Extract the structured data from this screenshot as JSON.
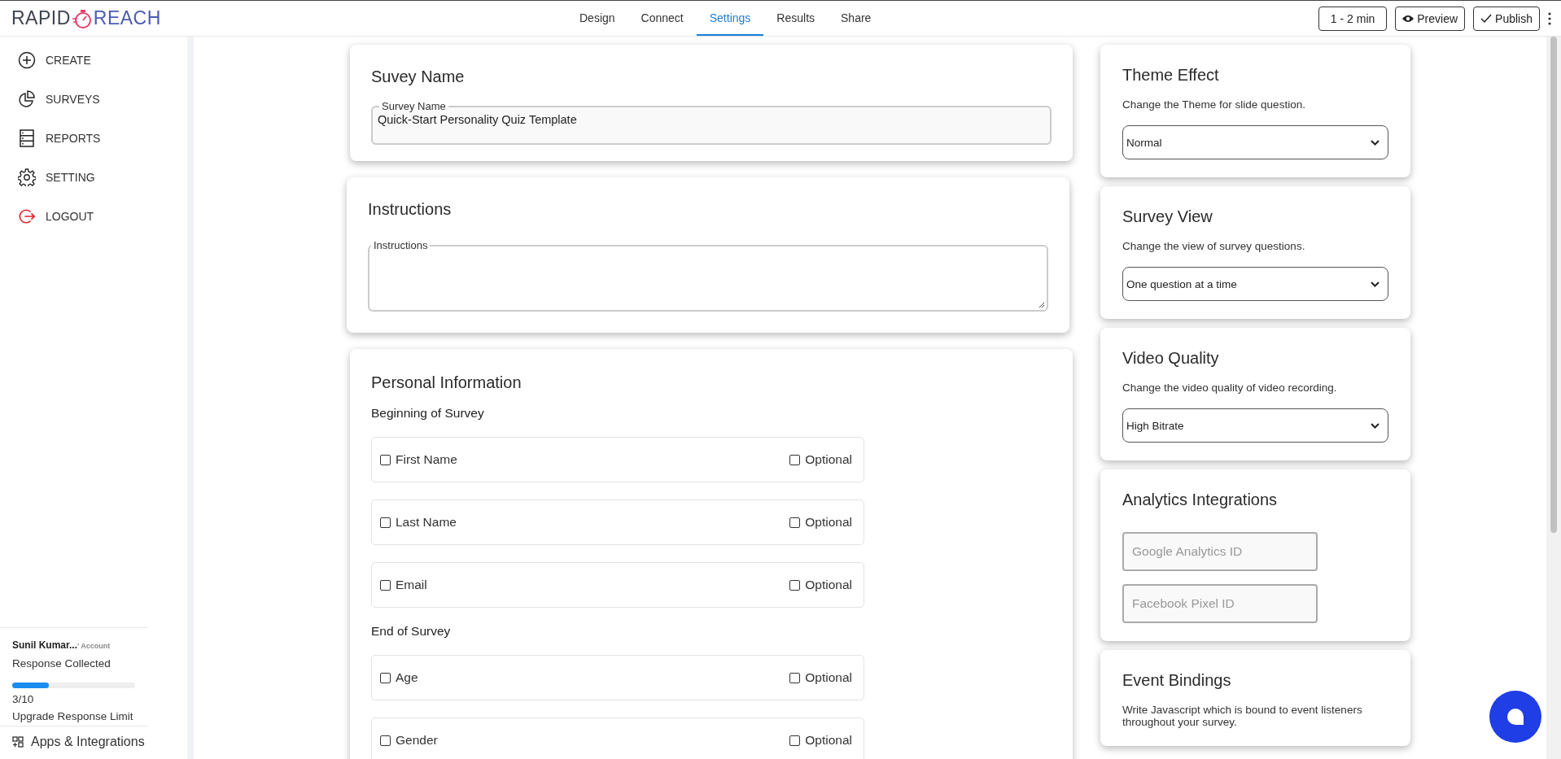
{
  "header": {
    "logo_left": "RAPID",
    "logo_right": "REACH",
    "tabs": [
      {
        "label": "Design",
        "selected": false
      },
      {
        "label": "Connect",
        "selected": false
      },
      {
        "label": "Settings",
        "selected": true
      },
      {
        "label": "Results",
        "selected": false
      },
      {
        "label": "Share",
        "selected": false
      }
    ],
    "duration": "1 - 2 min",
    "preview": "Preview",
    "publish": "Publish"
  },
  "sidebar": {
    "items": [
      {
        "label": "CREATE"
      },
      {
        "label": "SURVEYS"
      },
      {
        "label": "REPORTS"
      },
      {
        "label": "SETTING"
      },
      {
        "label": "LOGOUT"
      }
    ],
    "account": {
      "name": "Sunil Kumar...",
      "suffix": "' Account"
    },
    "usage": {
      "label": "Response Collected",
      "level": 0.3,
      "count": "3/10",
      "upgrade": "Upgrade Response Limit"
    },
    "apps": "Apps & Integrations"
  },
  "survey_name": {
    "title": "Suvey Name",
    "field_label": "Survey Name",
    "value": "Quick-Start Personality Quiz Template"
  },
  "instructions": {
    "title": "Instructions",
    "field_label": "Instructions"
  },
  "personal_information": {
    "title": "Personal Information",
    "groups": [
      {
        "heading": "Beginning of Survey",
        "fields": [
          {
            "label": "First Name",
            "checked": false,
            "optional_label": "Optional",
            "optional_checked": false
          },
          {
            "label": "Last Name",
            "checked": false,
            "optional_label": "Optional",
            "optional_checked": false
          },
          {
            "label": "Email",
            "checked": false,
            "optional_label": "Optional",
            "optional_checked": false
          }
        ]
      },
      {
        "heading": "End of Survey",
        "fields": [
          {
            "label": "Age",
            "checked": false,
            "optional_label": "Optional",
            "optional_checked": false
          },
          {
            "label": "Gender",
            "checked": false,
            "optional_label": "Optional",
            "optional_checked": false
          }
        ]
      }
    ]
  },
  "side_panels": [
    {
      "kind": "select",
      "title": "Theme Effect",
      "description": "Change the Theme for slide question.",
      "value": "Normal"
    },
    {
      "kind": "select",
      "title": "Survey View",
      "description": "Change the view of survey questions.",
      "value": "One question at a time"
    },
    {
      "kind": "select",
      "title": "Video Quality",
      "description": "Change the video quality of video recording.",
      "value": "High Bitrate"
    },
    {
      "kind": "inputs",
      "title": "Analytics Integrations",
      "placeholders": [
        "Google Analytics ID",
        "Facebook Pixel ID"
      ]
    },
    {
      "kind": "text",
      "title": "Event Bindings",
      "description": "Write Javascript which is bound to event listeners throughout your survey."
    }
  ]
}
